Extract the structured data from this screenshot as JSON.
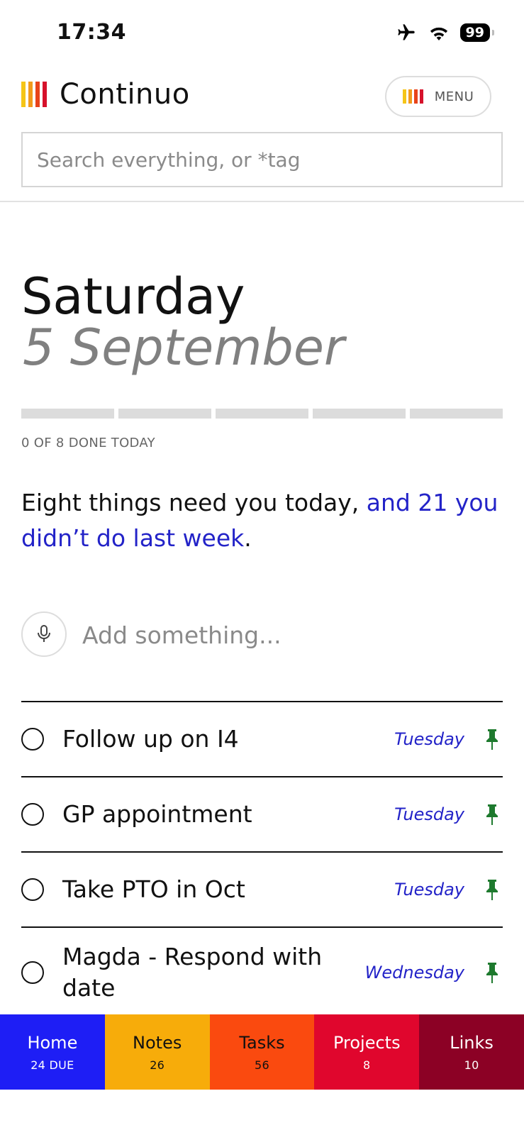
{
  "status_bar": {
    "time": "17:34",
    "battery": "99"
  },
  "header": {
    "app_title": "Continuo",
    "menu_label": "MENU",
    "logo_colors": [
      "#f5c518",
      "#f29a1c",
      "#e8431a",
      "#d6112b"
    ]
  },
  "search": {
    "placeholder": "Search everything, or *tag"
  },
  "today": {
    "day": "Saturday",
    "date": "5 September",
    "progress_done": 0,
    "progress_total": 8,
    "progress_label": "0 OF 8 DONE TODAY",
    "summary_text": "Eight things need you today, ",
    "summary_link": "and 21 you didn’t do last week",
    "summary_end": "."
  },
  "add": {
    "placeholder": "Add something..."
  },
  "tasks": [
    {
      "title": "Follow up on I4",
      "due": "Tuesday"
    },
    {
      "title": "GP appointment",
      "due": "Tuesday"
    },
    {
      "title": "Take PTO in Oct",
      "due": "Tuesday"
    },
    {
      "title": "Magda - Respond with date",
      "due": "Wednesday"
    }
  ],
  "tabs": [
    {
      "label": "Home",
      "count": "24 DUE",
      "color": "#1e1ef5",
      "text_color": "#ffffff"
    },
    {
      "label": "Notes",
      "count": "26",
      "color": "#f7ac0a",
      "text_color": "#111111"
    },
    {
      "label": "Tasks",
      "count": "56",
      "color": "#fa4a0f",
      "text_color": "#111111"
    },
    {
      "label": "Projects",
      "count": "8",
      "color": "#e0062d",
      "text_color": "#ffffff"
    },
    {
      "label": "Links",
      "count": "10",
      "color": "#8c0125",
      "text_color": "#ffffff"
    }
  ],
  "colors": {
    "accent_link": "#2323c8",
    "pin": "#1e7a2e"
  }
}
